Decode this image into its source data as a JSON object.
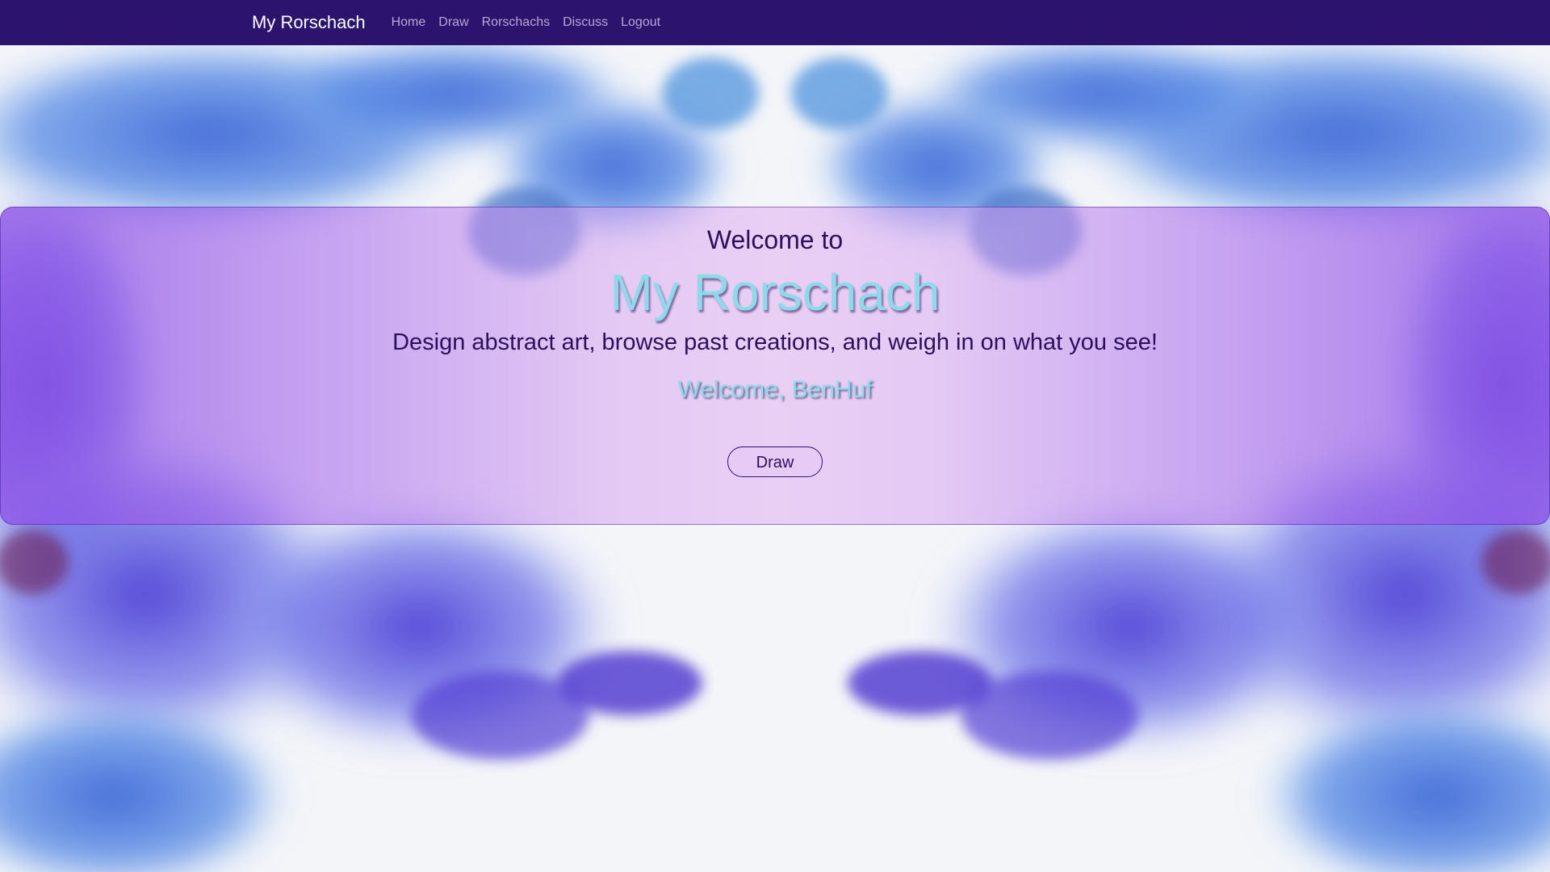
{
  "navbar": {
    "brand": "My Rorschach",
    "links": [
      {
        "label": "Home"
      },
      {
        "label": "Draw"
      },
      {
        "label": "Rorschachs"
      },
      {
        "label": "Discuss"
      },
      {
        "label": "Logout"
      }
    ]
  },
  "hero": {
    "welcome_to": "Welcome to",
    "title": "My Rorschach",
    "tagline": "Design abstract art, browse past creations, and weigh in on what you see!",
    "user_welcome": "Welcome, BenHuf",
    "draw_button": "Draw"
  },
  "colors": {
    "navbar": "#2c136d",
    "title_accent": "#8fd9ea",
    "text_dark": "#2c0f5c",
    "ink_blue": "#4a78d8",
    "ink_purple": "#6a4fe0"
  }
}
